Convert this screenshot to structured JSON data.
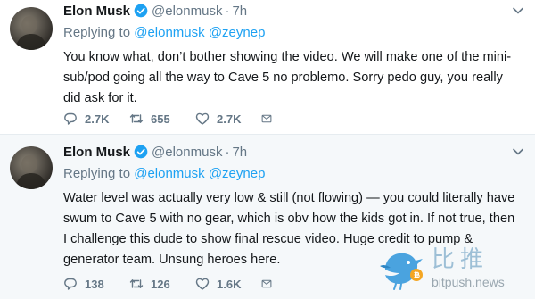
{
  "colors": {
    "accent": "#1da1f2",
    "muted": "#657786",
    "text": "#14171a",
    "retweet_green": "#17bf63"
  },
  "tweets": [
    {
      "name": "Elon Musk",
      "handle": "@elonmusk",
      "separator": "·",
      "time": "7h",
      "replying_label": "Replying to",
      "mentions": [
        "@elonmusk",
        "@zeynep"
      ],
      "text": "You know what, don’t bother showing the video. We will make one of the mini-sub/pod going all the way to Cave 5 no problemo. Sorry pedo guy, you really did ask for it.",
      "replies": "2.7K",
      "retweets": "655",
      "likes": "2.7K"
    },
    {
      "name": "Elon Musk",
      "handle": "@elonmusk",
      "separator": "·",
      "time": "7h",
      "replying_label": "Replying to",
      "mentions": [
        "@elonmusk",
        "@zeynep"
      ],
      "text": "Water level was actually very low & still (not flowing) — you could literally have swum to Cave 5 with no gear, which is obv how the kids got in. If not true, then I challenge this dude to show final rescue video. Huge credit to pump & generator team. Unsung heroes here.",
      "replies": "138",
      "retweets": "126",
      "likes": "1.6K"
    }
  ],
  "watermark": {
    "chinese": "比推",
    "site": "bitpush.news"
  },
  "icons": {
    "verified": "verified-badge-icon",
    "caret": "chevron-down-icon",
    "reply": "reply-icon",
    "retweet": "retweet-icon",
    "like": "heart-icon",
    "dm": "envelope-icon"
  }
}
